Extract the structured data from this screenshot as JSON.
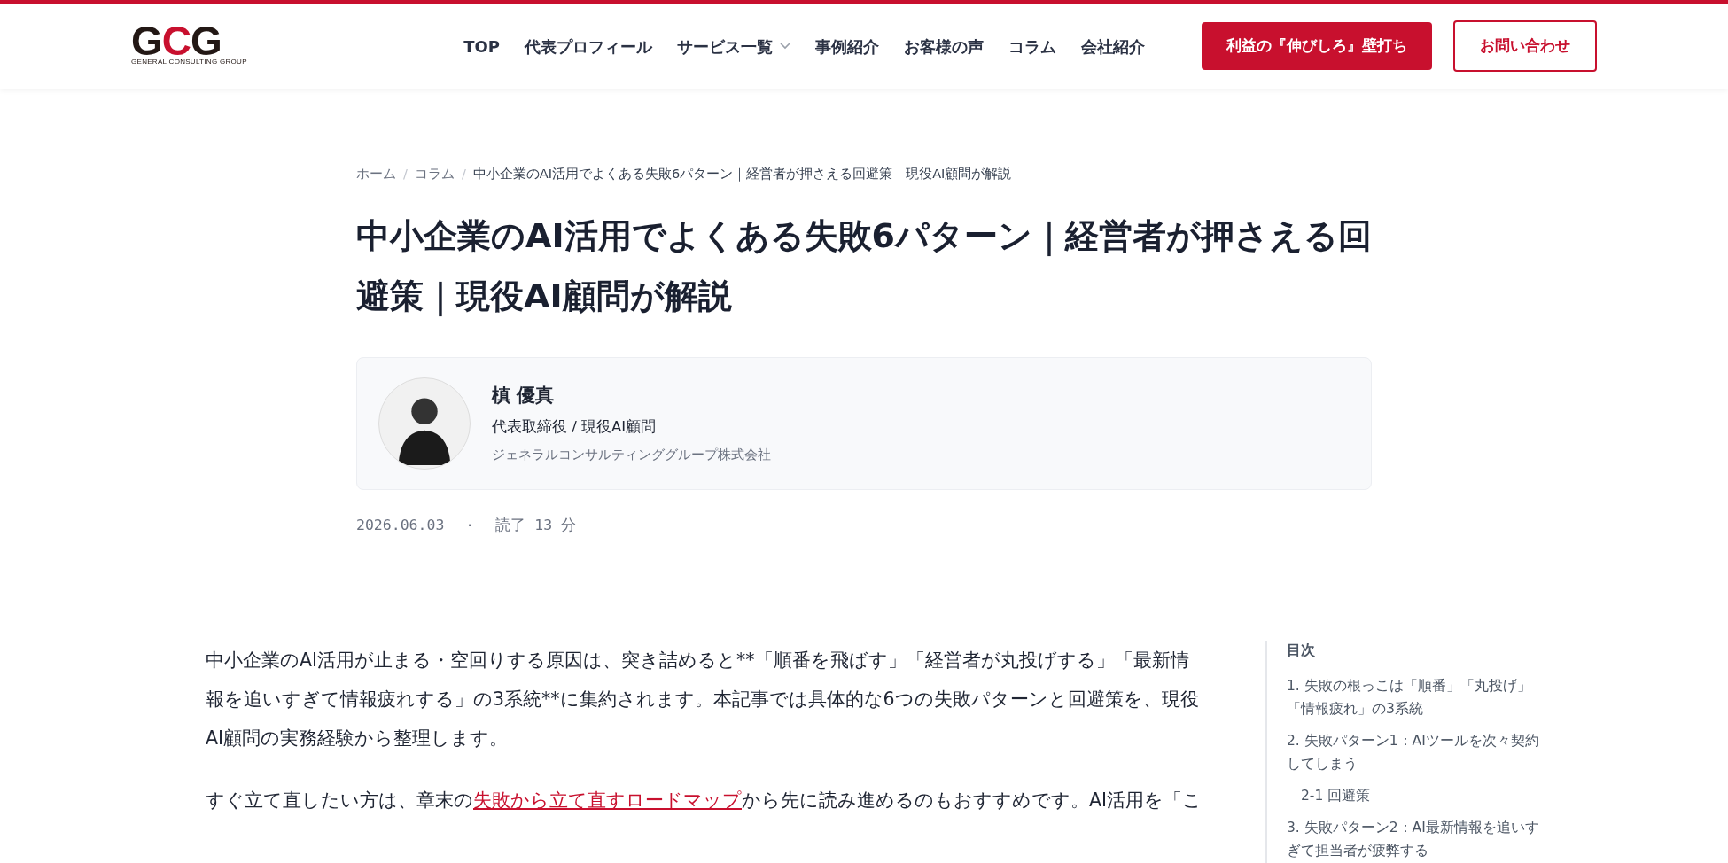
{
  "header": {
    "logo": {
      "letters": [
        {
          "text": "G",
          "accent": false
        },
        {
          "text": "C",
          "accent": true
        },
        {
          "text": "G",
          "accent": false
        }
      ],
      "subtitle": "GENERAL CONSULTING GROUP"
    },
    "nav": [
      {
        "label": "TOP",
        "dropdown": false
      },
      {
        "label": "代表プロフィール",
        "dropdown": false
      },
      {
        "label": "サービス一覧",
        "dropdown": true
      },
      {
        "label": "事例紹介",
        "dropdown": false
      },
      {
        "label": "お客様の声",
        "dropdown": false
      },
      {
        "label": "コラム",
        "dropdown": false
      },
      {
        "label": "会社紹介",
        "dropdown": false
      }
    ],
    "buttons": [
      {
        "label": "利益の『伸びしろ』壁打ち",
        "kind": "filled"
      },
      {
        "label": "お問い合わせ",
        "kind": "outline"
      }
    ]
  },
  "breadcrumb": {
    "separator": "/",
    "items": [
      "ホーム",
      "コラム",
      "中小企業のAI活用でよくある失敗6パターン｜経営者が押さえる回避策｜現役AI顧問が解説"
    ]
  },
  "title": "中小企業のAI活用でよくある失敗6パターン｜経営者が押さえる回避策｜現役AI顧問が解説",
  "author": {
    "name": "槙 優真",
    "role": "代表取締役 / 現役AI顧問",
    "company": "ジェネラルコンサルティンググループ株式会社"
  },
  "meta": {
    "date": "2026.06.03",
    "separator": "·",
    "reading_time": "読了 13 分"
  },
  "article": {
    "paragraphs": [
      {
        "parts": [
          {
            "text": "中小企業のAI活用が止まる・空回りする原因は、突き詰めると**「順番を飛ばす」「経営者が丸投げする」「最新情報を追いすぎて情報疲れする」の3系統**に集約されます。本記事では具体的な6つの失敗パターンと回避策を、現役AI顧問の実務経験から整理します。",
            "link": false
          }
        ]
      },
      {
        "parts": [
          {
            "text": "すぐ立て直したい方は、章末の",
            "link": false
          },
          {
            "text": "失敗から立て直すロードマップ",
            "link": true
          },
          {
            "text": "から先に読み進めるのもおすすめです。AI活用を「こ",
            "link": false
          }
        ]
      }
    ]
  },
  "toc": {
    "title": "目次",
    "items": [
      {
        "label": "1. 失敗の根っこは「順番」「丸投げ」「情報疲れ」の3系統"
      },
      {
        "label": "2. 失敗パターン1：AIツールを次々契約してしまう",
        "children": [
          {
            "label": "2-1 回避策"
          }
        ]
      },
      {
        "label": "3. 失敗パターン2：AI最新情報を追いすぎて担当者が疲弊する"
      }
    ]
  }
}
